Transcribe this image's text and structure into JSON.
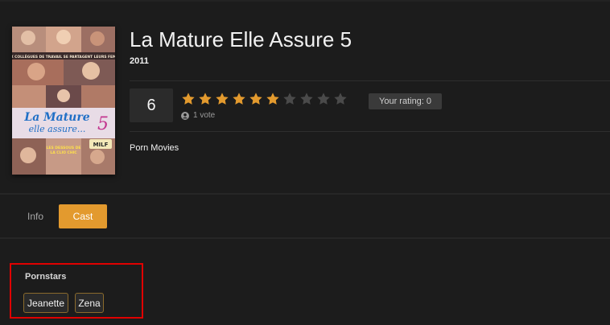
{
  "movie": {
    "title": "La Mature Elle Assure 5",
    "year": "2011",
    "category": "Porn Movies"
  },
  "poster": {
    "banner_text": "DEUX COLLÈGUES DE TRAVAIL SE PARTAGENT LEURS FEMMES",
    "title_line1": "La Mature",
    "title_line2": "elle assure...",
    "number": "5",
    "tagline_line1": "LES DESSOUS DE",
    "tagline_line2": "LA CLIO CHIC",
    "badge": "MILF"
  },
  "rating": {
    "score": "6",
    "filled_stars": 6,
    "total_stars": 10,
    "votes_label": "1 vote",
    "your_rating_label": "Your rating: 0",
    "star_color": "#e39a2e",
    "empty_star_color": "#4a4a4a"
  },
  "tabs": [
    {
      "label": "Info",
      "active": false
    },
    {
      "label": "Cast",
      "active": true
    }
  ],
  "cast": {
    "heading": "Pornstars",
    "names": [
      "Jeanette",
      "Zena"
    ]
  },
  "colors": {
    "accent": "#e39a2e",
    "background": "#1c1c1c",
    "highlight": "#e00000"
  }
}
